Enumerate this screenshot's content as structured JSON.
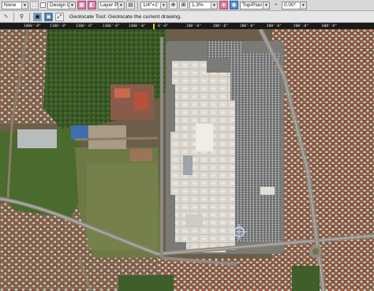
{
  "toolbar_top": {
    "level_value": "None",
    "design_value": "Design Lv",
    "layer_value": "Layer Pt",
    "scale_value": "1/4\"=1'",
    "percent_value": "1.3%",
    "view_value": "Top/Plan",
    "angle_value": "0.00°"
  },
  "toolbar_second": {
    "status_text": "Geolocate Tool: Geolocate the current drawing."
  },
  "ruler": {
    "labels": [
      "1000'-0\"",
      "1100'-0\"",
      "1200'-0\"",
      "1300'-0\"",
      "1400'-0\"",
      "0'-0\"",
      "100'-0\"",
      "200'-0\"",
      "300'-0\"",
      "400'-0\"",
      "500'-0\"",
      "600'-0\""
    ]
  },
  "icons": {
    "level": "level-icon",
    "pushpin": "pushpin-icon",
    "camera": "camera-icon",
    "flyover": "flyover-icon",
    "zoom": "zoom-icon",
    "globe": "globe-icon",
    "angle": "angle-icon"
  },
  "colors": {
    "toolbar": "#d8d8d8",
    "ruler": "#1a1a1a",
    "roof": "#d9d4cc",
    "vegetation": "#3f5e2a",
    "crosshair": "#b9cdf2"
  }
}
